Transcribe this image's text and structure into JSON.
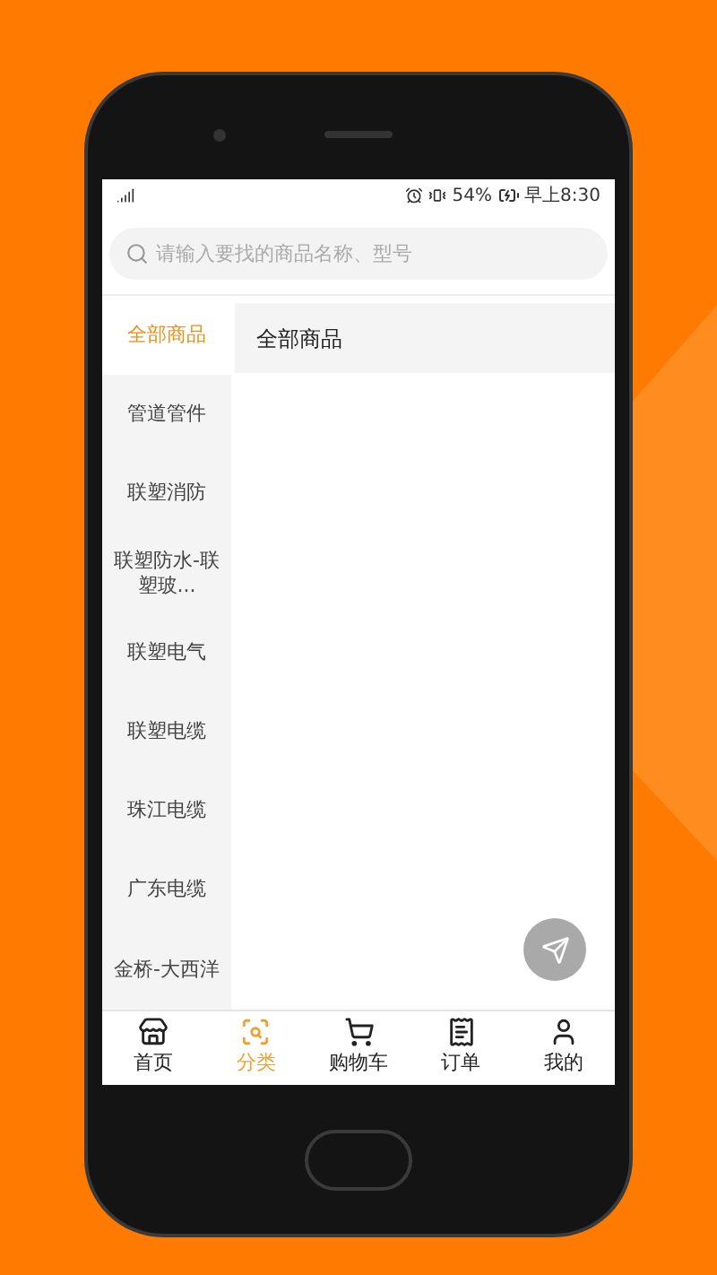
{
  "status_bar": {
    "battery_percent": "54%",
    "time": "早上8:30"
  },
  "search": {
    "placeholder": "请输入要找的商品名称、型号"
  },
  "sidebar": {
    "items": [
      {
        "label": "全部商品",
        "selected": true
      },
      {
        "label": "管道管件",
        "selected": false
      },
      {
        "label": "联塑消防",
        "selected": false
      },
      {
        "label": "联塑防水-联塑玻...",
        "selected": false
      },
      {
        "label": "联塑电气",
        "selected": false
      },
      {
        "label": "联塑电缆",
        "selected": false
      },
      {
        "label": "珠江电缆",
        "selected": false
      },
      {
        "label": "广东电缆",
        "selected": false
      },
      {
        "label": "金桥-大西洋",
        "selected": false
      }
    ]
  },
  "content": {
    "header": "全部商品"
  },
  "tab_bar": [
    {
      "label": "首页",
      "kind": "home",
      "selected": false
    },
    {
      "label": "分类",
      "kind": "category",
      "selected": true
    },
    {
      "label": "购物车",
      "kind": "cart",
      "selected": false
    },
    {
      "label": "订单",
      "kind": "orders",
      "selected": false
    },
    {
      "label": "我的",
      "kind": "profile",
      "selected": false
    }
  ]
}
